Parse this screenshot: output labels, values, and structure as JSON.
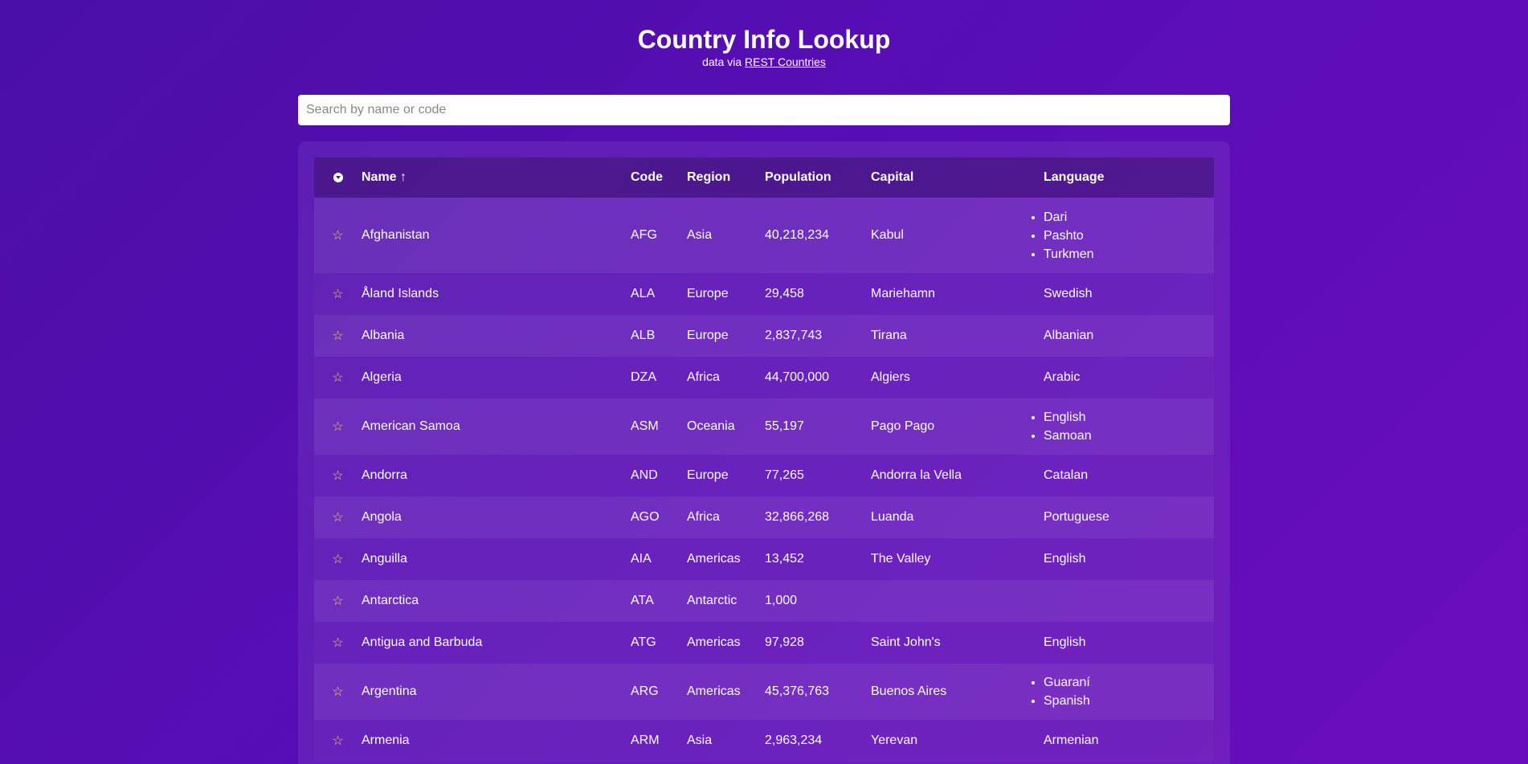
{
  "header": {
    "title": "Country Info Lookup",
    "subtitle_prefix": "data via",
    "subtitle_link": "REST Countries"
  },
  "search": {
    "placeholder": "Search by name or code",
    "value": ""
  },
  "table": {
    "columns": [
      "",
      "Name ↑",
      "Code",
      "Region",
      "Population",
      "Capital",
      "Language"
    ],
    "sort_column": "Name",
    "sort_direction": "ascending",
    "star_icon": "☆",
    "rows": [
      {
        "name": "Afghanistan",
        "code": "AFG",
        "region": "Asia",
        "population": "40,218,234",
        "capital": "Kabul",
        "languages": [
          "Dari",
          "Pashto",
          "Turkmen"
        ]
      },
      {
        "name": "Åland Islands",
        "code": "ALA",
        "region": "Europe",
        "population": "29,458",
        "capital": "Mariehamn",
        "languages": [
          "Swedish"
        ]
      },
      {
        "name": "Albania",
        "code": "ALB",
        "region": "Europe",
        "population": "2,837,743",
        "capital": "Tirana",
        "languages": [
          "Albanian"
        ]
      },
      {
        "name": "Algeria",
        "code": "DZA",
        "region": "Africa",
        "population": "44,700,000",
        "capital": "Algiers",
        "languages": [
          "Arabic"
        ]
      },
      {
        "name": "American Samoa",
        "code": "ASM",
        "region": "Oceania",
        "population": "55,197",
        "capital": "Pago Pago",
        "languages": [
          "English",
          "Samoan"
        ]
      },
      {
        "name": "Andorra",
        "code": "AND",
        "region": "Europe",
        "population": "77,265",
        "capital": "Andorra la Vella",
        "languages": [
          "Catalan"
        ]
      },
      {
        "name": "Angola",
        "code": "AGO",
        "region": "Africa",
        "population": "32,866,268",
        "capital": "Luanda",
        "languages": [
          "Portuguese"
        ]
      },
      {
        "name": "Anguilla",
        "code": "AIA",
        "region": "Americas",
        "population": "13,452",
        "capital": "The Valley",
        "languages": [
          "English"
        ]
      },
      {
        "name": "Antarctica",
        "code": "ATA",
        "region": "Antarctic",
        "population": "1,000",
        "capital": "",
        "languages": []
      },
      {
        "name": "Antigua and Barbuda",
        "code": "ATG",
        "region": "Americas",
        "population": "97,928",
        "capital": "Saint John's",
        "languages": [
          "English"
        ]
      },
      {
        "name": "Argentina",
        "code": "ARG",
        "region": "Americas",
        "population": "45,376,763",
        "capital": "Buenos Aires",
        "languages": [
          "Guaraní",
          "Spanish"
        ]
      },
      {
        "name": "Armenia",
        "code": "ARM",
        "region": "Asia",
        "population": "2,963,234",
        "capital": "Yerevan",
        "languages": [
          "Armenian"
        ]
      }
    ]
  },
  "colors": {
    "accent_star": "#ffcc44",
    "background_start": "#4a0fa8",
    "background_end": "#6a0dbb"
  }
}
